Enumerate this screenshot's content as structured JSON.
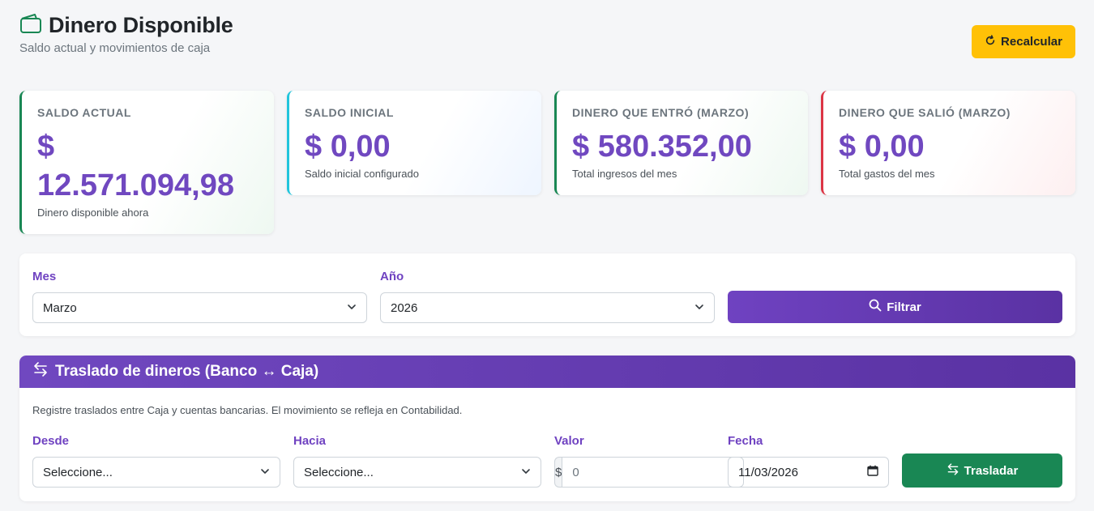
{
  "header": {
    "title": "Dinero Disponible",
    "subtitle": "Saldo actual y movimientos de caja",
    "title_icon": "wallet-icon",
    "recalc_label": "Recalcular"
  },
  "cards": [
    {
      "label": "SALDO ACTUAL",
      "value": "$ 12.571.094,98",
      "desc": "Dinero disponible ahora",
      "accent": "#198754"
    },
    {
      "label": "SALDO INICIAL",
      "value": "$ 0,00",
      "desc": "Saldo inicial configurado",
      "accent": "#22c5dc"
    },
    {
      "label": "DINERO QUE ENTRÓ (MARZO)",
      "value": "$ 580.352,00",
      "desc": "Total ingresos del mes",
      "accent": "#198754"
    },
    {
      "label": "DINERO QUE SALIÓ (MARZO)",
      "value": "$ 0,00",
      "desc": "Total gastos del mes",
      "accent": "#dc3545"
    }
  ],
  "filter": {
    "month_label": "Mes",
    "month_value": "Marzo",
    "year_label": "Año",
    "year_value": "2026",
    "button_label": "Filtrar"
  },
  "transfer": {
    "title": "Traslado de dineros (Banco ↔ Caja)",
    "info": "Registre traslados entre Caja y cuentas bancarias. El movimiento se refleja en Contabilidad.",
    "from_label": "Desde",
    "from_value": "Seleccione...",
    "to_label": "Hacia",
    "to_value": "Seleccione...",
    "amount_label": "Valor",
    "currency_symbol": "$",
    "amount_placeholder": "0",
    "date_label": "Fecha",
    "date_value": "11/03/2026",
    "button_label": "Trasladar"
  },
  "colors": {
    "accent_purple": "#6f42c1",
    "value_purple": "#7048c0",
    "warning": "#ffc107",
    "success": "#198754",
    "danger": "#dc3545",
    "info": "#22c5dc"
  }
}
